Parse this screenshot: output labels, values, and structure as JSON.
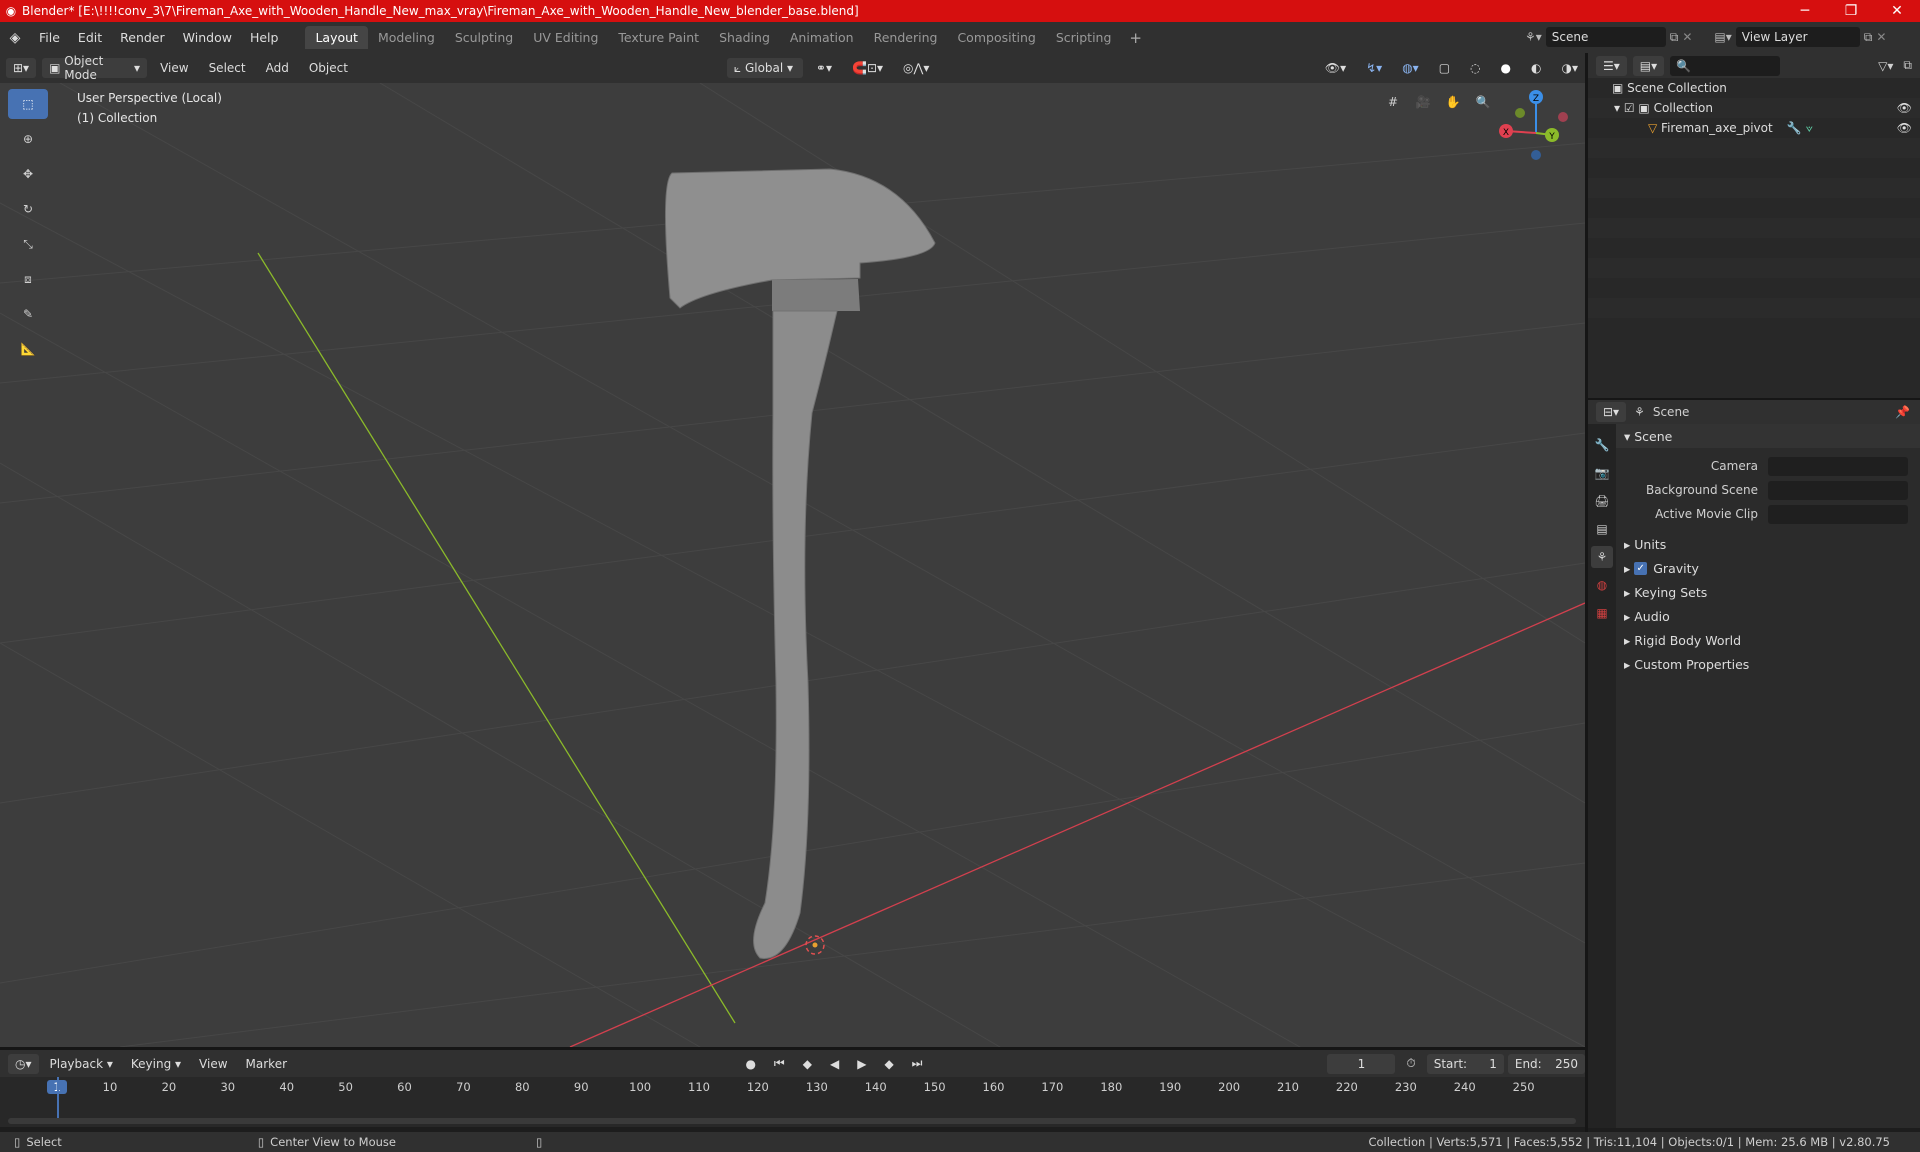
{
  "window": {
    "title": "Blender* [E:\\!!!!conv_3\\7\\Fireman_Axe_with_Wooden_Handle_New_max_vray\\Fireman_Axe_with_Wooden_Handle_New_blender_base.blend]",
    "minimize": "─",
    "maximize": "❐",
    "close": "✕"
  },
  "menu": [
    "File",
    "Edit",
    "Render",
    "Window",
    "Help"
  ],
  "workspaces": [
    "Layout",
    "Modeling",
    "Sculpting",
    "UV Editing",
    "Texture Paint",
    "Shading",
    "Animation",
    "Rendering",
    "Compositing",
    "Scripting"
  ],
  "active_workspace": "Layout",
  "scene_name": "Scene",
  "view_layer": "View Layer",
  "viewport": {
    "mode": "Object Mode",
    "menus": [
      "View",
      "Select",
      "Add",
      "Object"
    ],
    "orientation": "Global",
    "perspective_label": "User Perspective (Local)",
    "collection_label": "(1) Collection",
    "axes": {
      "x": "X",
      "y": "Y",
      "z": "Z"
    }
  },
  "outliner": {
    "root": "Scene Collection",
    "collection": "Collection",
    "object": "Fireman_axe_pivot"
  },
  "properties": {
    "context": "Scene",
    "panel": "Scene",
    "fields": [
      "Camera",
      "Background Scene",
      "Active Movie Clip"
    ],
    "sections": [
      "Units",
      "Gravity",
      "Keying Sets",
      "Audio",
      "Rigid Body World",
      "Custom Properties"
    ]
  },
  "timeline": {
    "menus": [
      "Playback",
      "Keying",
      "View",
      "Marker"
    ],
    "current_frame": "1",
    "start_label": "Start:",
    "start": "1",
    "end_label": "End:",
    "end": "250",
    "ticks": [
      "1",
      "10",
      "20",
      "30",
      "40",
      "50",
      "60",
      "70",
      "80",
      "90",
      "100",
      "110",
      "120",
      "130",
      "140",
      "150",
      "160",
      "170",
      "180",
      "190",
      "200",
      "210",
      "220",
      "230",
      "240",
      "250"
    ]
  },
  "status": {
    "select": "Select",
    "center": "Center View to Mouse",
    "stats": "Collection | Verts:5,571 | Faces:5,552 | Tris:11,104 | Objects:0/1 | Mem: 25.6 MB | v2.80.75"
  },
  "colors": {
    "accent": "#4772b3",
    "title_bar": "#d60f0f",
    "x_axis": "#e04050",
    "y_axis": "#8bba2a",
    "z_axis": "#3b8fe8"
  }
}
